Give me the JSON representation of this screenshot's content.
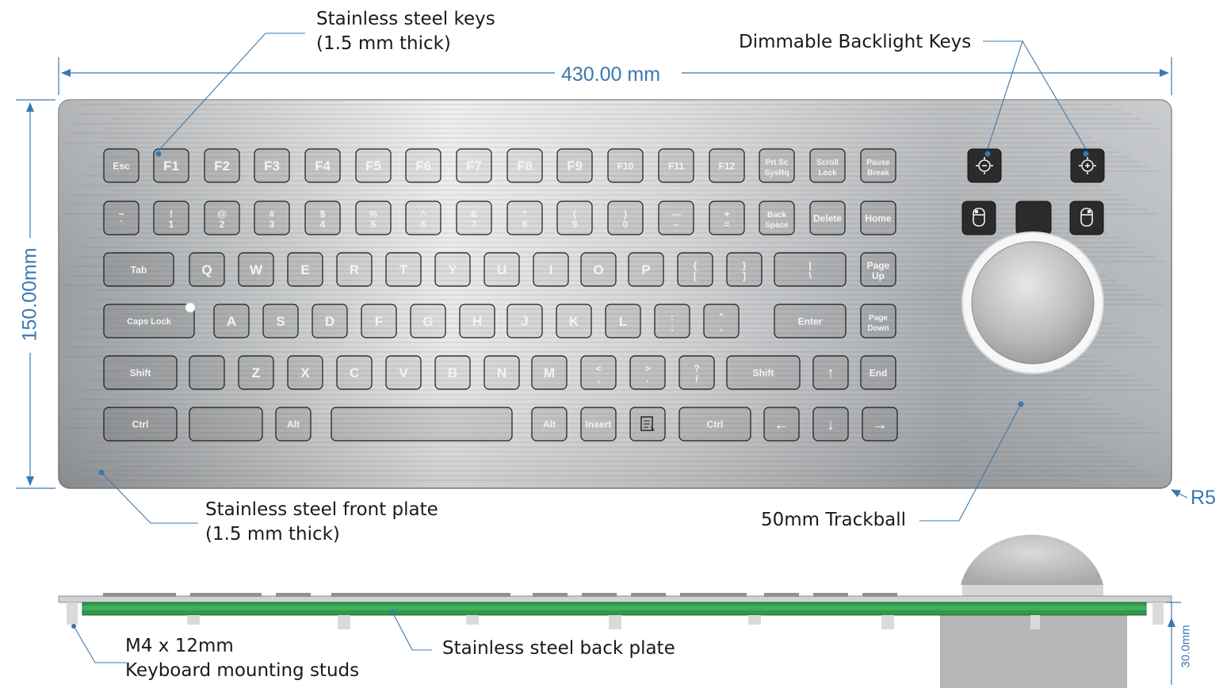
{
  "dimensions": {
    "width": "430.00 mm",
    "height": "150.00mm",
    "corner_radius": "R5",
    "depth": "30.0mm"
  },
  "callouts": {
    "keys_line1": "Stainless steel keys",
    "keys_line2": "(1.5 mm thick)",
    "backlight": "Dimmable Backlight Keys",
    "plate_line1": "Stainless steel front plate",
    "plate_line2": "(1.5 mm thick)",
    "trackball": "50mm Trackball",
    "studs_line1": "M4 x 12mm",
    "studs_line2": "Keyboard mounting studs",
    "back_plate": "Stainless steel back plate"
  },
  "keys": {
    "row1": [
      "Esc",
      "F1",
      "F2",
      "F3",
      "F4",
      "F5",
      "F6",
      "F7",
      "F8",
      "F9",
      "F10",
      "F11",
      "F12",
      "Prt Sc\nSysRq",
      "Scroll\nLock",
      "Pause\nBreak"
    ],
    "row2": [
      "~\n`",
      "!\n1",
      "@\n2",
      "#\n3",
      "$\n4",
      "%\n5",
      "^\n6",
      "&\n7",
      "*\n8",
      "(\n9",
      ")\n0",
      "—\n–",
      "+\n=",
      "Back\nSpace",
      "Delete",
      "Home"
    ],
    "row3": [
      "Tab",
      "Q",
      "W",
      "E",
      "R",
      "T",
      "Y",
      "U",
      "I",
      "O",
      "P",
      "{\n[",
      "}\n]",
      "|\n\\",
      "Page\nUp"
    ],
    "row4": [
      "Caps Lock",
      "A",
      "S",
      "D",
      "F",
      "G",
      "H",
      "J",
      "K",
      "L",
      ":\n;",
      "\"\n,",
      "Enter",
      "Page\nDown"
    ],
    "row5": [
      "Shift",
      "",
      "Z",
      "X",
      "C",
      "V",
      "B",
      "N",
      "M",
      "<\n,",
      ">\n.",
      "?\n/",
      "Shift",
      "↑",
      "End"
    ],
    "row6": [
      "Ctrl",
      "",
      "Alt",
      "",
      "Alt",
      "Insert",
      "menu",
      "Ctrl",
      "←",
      "↓",
      "→"
    ]
  },
  "colors": {
    "accent": "#3a78b0",
    "key": "#2b2b2b",
    "pcb": "#2e9a4a",
    "plate": "#b9bcbf",
    "leader": "#3a78b0"
  },
  "icons": [
    "brightness-down-icon",
    "brightness-up-icon",
    "mouse-left-icon",
    "mouse-right-icon",
    "arrow-up-icon",
    "arrow-left-icon",
    "arrow-down-icon",
    "arrow-right-icon",
    "context-menu-icon",
    "caps-lock-led-icon",
    "trackball-icon"
  ]
}
